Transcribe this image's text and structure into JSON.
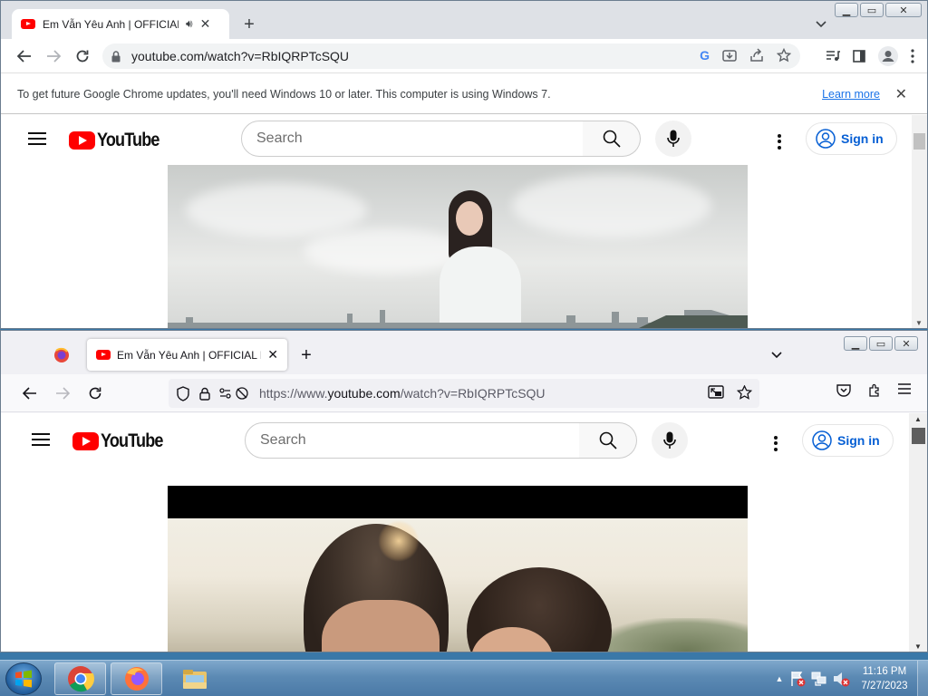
{
  "chrome": {
    "tab_title": "Em Vẫn Yêu Anh | OFFICIAL MUSIC VIDEO",
    "url": "youtube.com/watch?v=RbIQRPTcSQU",
    "infobar_text": "To get future Google Chrome updates, you'll need Windows 10 or later. This computer is using Windows 7.",
    "infobar_link": "Learn more"
  },
  "firefox": {
    "tab_title": "Em Vẫn Yêu Anh | OFFICIAL MUSIC VIDEO",
    "url_prefix": "https://www.",
    "url_host": "youtube.com",
    "url_path": "/watch?v=RbIQRPTcSQU"
  },
  "youtube": {
    "logo_text": "YouTube",
    "search_placeholder": "Search",
    "signin_label": "Sign in",
    "brand_color": "#ff0000",
    "link_color": "#065fd4"
  },
  "taskbar": {
    "apps": [
      "chrome-icon",
      "firefox-icon",
      "file-explorer-icon"
    ],
    "time": "11:16 PM",
    "date": "7/27/2023"
  }
}
